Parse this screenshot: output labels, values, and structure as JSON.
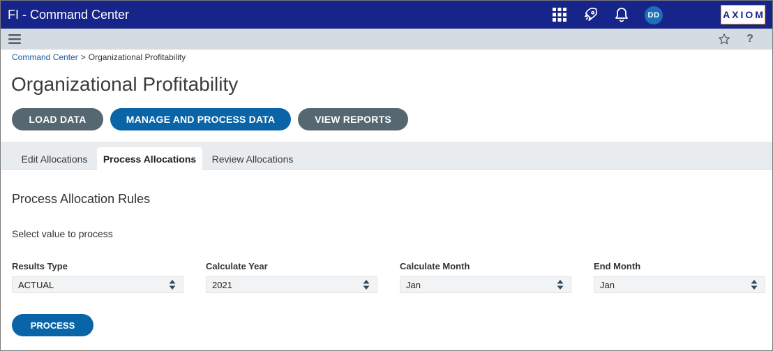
{
  "header": {
    "app_title": "FI - Command Center",
    "avatar_initials": "DD",
    "brand": "AXIOM",
    "icons": [
      "apps-grid-icon",
      "rocket-icon",
      "bell-icon"
    ],
    "colors": {
      "bar": "#17258a",
      "brand_border": "#f39a2b"
    }
  },
  "subbar": {
    "icons": [
      "hamburger-menu-icon",
      "star-icon",
      "help-icon"
    ],
    "help_glyph": "?"
  },
  "breadcrumb": {
    "link": "Command Center",
    "separator": ">",
    "current": "Organizational Profitability"
  },
  "page": {
    "title": "Organizational Profitability"
  },
  "actions": {
    "load": "LOAD DATA",
    "manage": "MANAGE AND PROCESS DATA",
    "view": "VIEW REPORTS",
    "colors": {
      "gray": "#556872",
      "blue": "#0a64a8"
    }
  },
  "tabs": [
    {
      "label": "Edit Allocations",
      "active": false
    },
    {
      "label": "Process Allocations",
      "active": true
    },
    {
      "label": "Review Allocations",
      "active": false
    }
  ],
  "section": {
    "title": "Process Allocation Rules",
    "helper": "Select value to process"
  },
  "fields": [
    {
      "label": "Results Type",
      "value": "ACTUAL"
    },
    {
      "label": "Calculate Year",
      "value": "2021"
    },
    {
      "label": "Calculate Month",
      "value": "Jan"
    },
    {
      "label": "End Month",
      "value": "Jan"
    }
  ],
  "process_button": "PROCESS"
}
